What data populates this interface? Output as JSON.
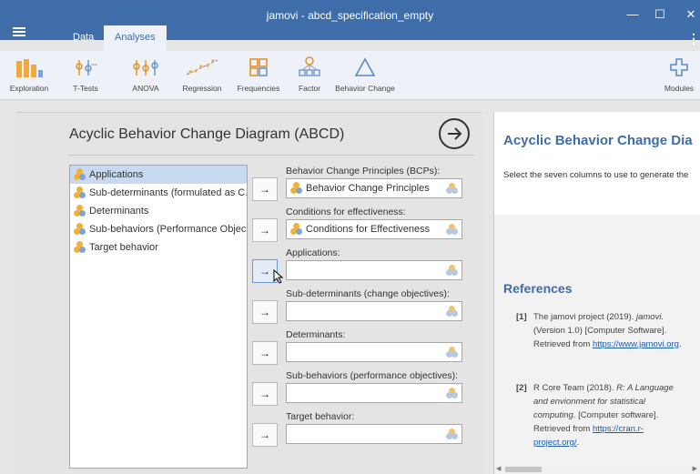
{
  "window": {
    "title": "jamovi - abcd_specification_empty",
    "minimize": "—",
    "maximize": "☐",
    "close": "✕"
  },
  "tabs": [
    {
      "label": "Data"
    },
    {
      "label": "Analyses"
    }
  ],
  "toolbar": {
    "items": [
      {
        "label": "Exploration",
        "icon": "exploration-icon"
      },
      {
        "label": "T-Tests",
        "icon": "t-tests-icon"
      },
      {
        "label": "ANOVA",
        "icon": "anova-icon"
      },
      {
        "label": "Regression",
        "icon": "regression-icon"
      },
      {
        "label": "Frequencies",
        "icon": "frequencies-icon"
      },
      {
        "label": "Factor",
        "icon": "factor-icon"
      },
      {
        "label": "Behavior Change",
        "icon": "behavior-change-icon"
      }
    ],
    "modules": "Modules"
  },
  "options": {
    "title": "Acyclic Behavior Change Diagram (ABCD)",
    "variables": [
      {
        "name": "Applications",
        "selected": true
      },
      {
        "name": "Sub-determinants (formulated as C...",
        "selected": false
      },
      {
        "name": "Determinants",
        "selected": false
      },
      {
        "name": "Sub-behaviors (Performance Objec...",
        "selected": false
      },
      {
        "name": "Target behavior",
        "selected": false
      }
    ],
    "arrow": "→",
    "targets": [
      {
        "label": "Behavior Change Principles (BCPs):",
        "value": "Behavior Change Principles"
      },
      {
        "label": "Conditions for effectiveness:",
        "value": "Conditions for Effectiveness"
      },
      {
        "label": "Applications:",
        "value": ""
      },
      {
        "label": "Sub-determinants (change objectives):",
        "value": ""
      },
      {
        "label": "Determinants:",
        "value": ""
      },
      {
        "label": "Sub-behaviors (performance objectives):",
        "value": ""
      },
      {
        "label": "Target behavior:",
        "value": ""
      }
    ]
  },
  "results": {
    "title": "Acyclic Behavior Change Dia",
    "text": "Select the seven columns to use to generate the",
    "references_title": "References",
    "ref1": {
      "num": "[1]",
      "pre": "The jamovi project (2019). ",
      "ital": "jamovi.",
      "rest": " (Version 1.0) [Computer Software]. Retrieved from ",
      "link": "https://www.jamovi.org",
      "end": "."
    },
    "ref2": {
      "num": "[2]",
      "pre": "R Core Team (2018). ",
      "ital": "R: A Language and envionment for statistical computing.",
      "rest": " [Computer software]. Retrieved from ",
      "link": "https://cran.r-project.org/",
      "end": "."
    }
  },
  "colors": {
    "accent": "#3e6da9",
    "selected": "#c8daf2"
  }
}
